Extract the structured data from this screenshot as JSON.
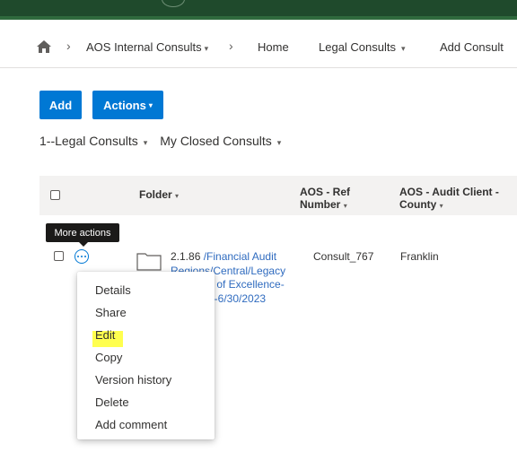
{
  "breadcrumb": {
    "items": [
      {
        "label": "AOS Internal Consults",
        "caret": "▾"
      },
      {
        "label": "Home"
      },
      {
        "label": "Legal Consults",
        "caret": "▾"
      },
      {
        "label": "Add Consult"
      }
    ],
    "separator": "›"
  },
  "toolbar": {
    "add_label": "Add",
    "actions_label": "Actions"
  },
  "views": {
    "view1": "1--Legal Consults",
    "view2": "My Closed Consults"
  },
  "table": {
    "headers": {
      "folder": "Folder",
      "ref_line1": "AOS - Ref",
      "ref_line2": "Number",
      "county_line1": "AOS - Audit Client -",
      "county_line2": "County"
    },
    "row": {
      "folder_line1_num": "2.1.86",
      "folder_line1_path": " /Financial Audit",
      "folder_line2": "Regions/Central/Legacy",
      "folder_line3": "y of Excellence-",
      "folder_line4": "2-6/30/2023",
      "ref": "Consult_767",
      "county": "Franklin"
    }
  },
  "tooltip": {
    "text": "More actions"
  },
  "context_menu": {
    "items": [
      "Details",
      "Share",
      "Edit",
      "Copy",
      "Version history",
      "Delete",
      "Add comment"
    ],
    "highlighted": "Edit"
  },
  "colors": {
    "accent": "#0078d4",
    "top_band": "#1f4a2c",
    "highlight": "#ffff4f",
    "link": "#2f6bbf"
  },
  "icons": [
    "home-icon",
    "chevron-right-icon",
    "caret-down-icon",
    "folder-icon",
    "more-actions-icon",
    "checkbox-icon"
  ]
}
